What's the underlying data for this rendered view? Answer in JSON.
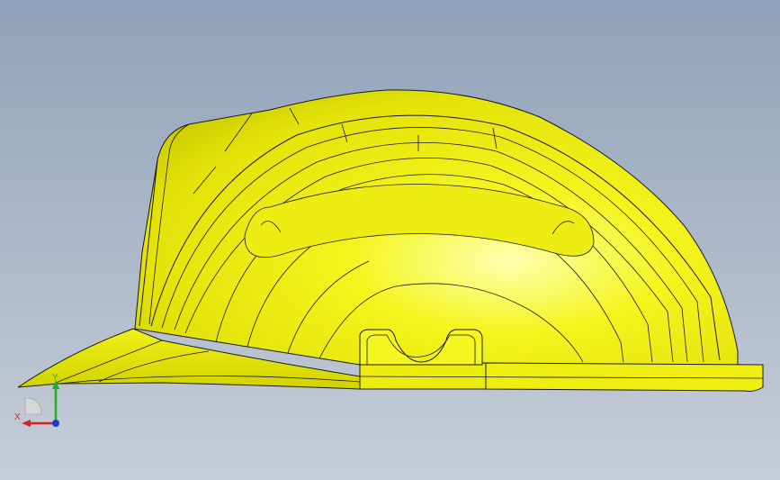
{
  "viewport": {
    "background_top": "#8fa1ba",
    "background_bottom": "#c7cdd8"
  },
  "model": {
    "object": "helmet",
    "view": "side",
    "color": "#f2f20f",
    "edge_color": "#1a1a1a"
  },
  "triad": {
    "x_label": "X",
    "y_label": "Y",
    "x_color": "#e02020",
    "y_color": "#20b020",
    "z_color": "#1a3cc8"
  }
}
